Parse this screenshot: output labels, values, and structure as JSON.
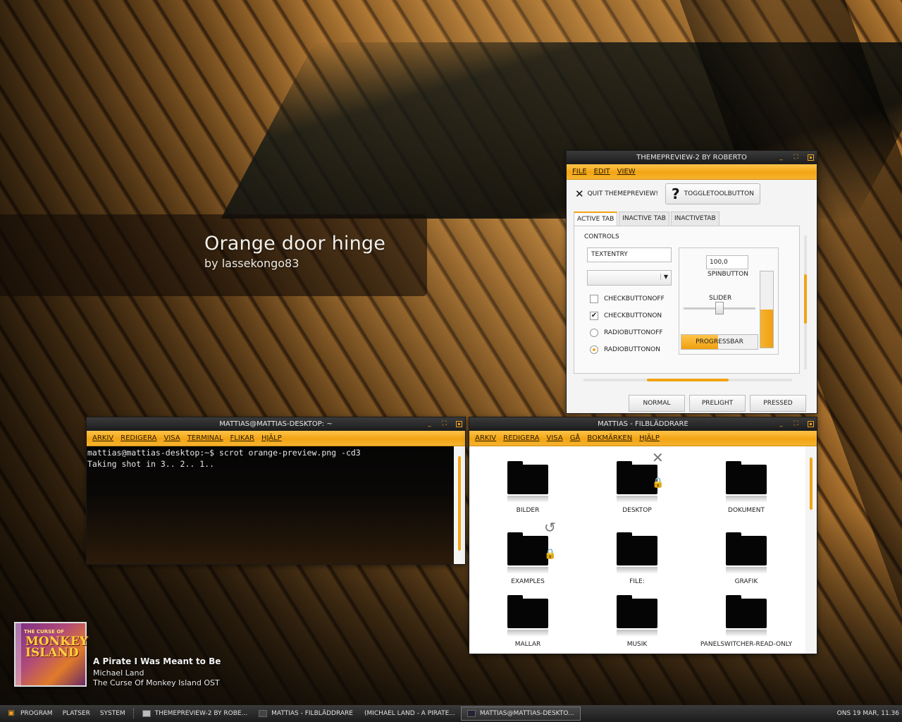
{
  "desktop": {
    "title": "Orange door hinge",
    "subtitle": "by lassekongo83"
  },
  "themepreview": {
    "title": "THEMEPREVIEW-2 BY ROBERTO",
    "menu": [
      "FILE",
      "EDIT",
      "VIEW"
    ],
    "quit_label": "QUIT THEMEPREVIEW!",
    "toggle_label": "TOGGLETOOLBUTTON",
    "tabs": [
      "ACTIVE TAB",
      "INACTIVE TAB",
      "INACTIVETAB"
    ],
    "controls_label": "CONTROLS",
    "textentry": "TEXTENTRY",
    "checkbutton_off": "CHECKBUTTONOFF",
    "checkbutton_on": "CHECKBUTTONON",
    "radiobutton_off": "RADIOBUTTONOFF",
    "radiobutton_on": "RADIOBUTTONON",
    "spin_value": "100,0",
    "spin_label": "SPINBUTTON",
    "slider_label": "SLIDER",
    "slider_value": 0.5,
    "progress_label": "PROGRESSBAR",
    "progress_value": 0.48,
    "vertical_progress_value": 0.5,
    "buttons": [
      "NORMAL",
      "PRELIGHT",
      "PRESSED"
    ]
  },
  "terminal": {
    "title": "MATTIAS@MATTIAS-DESKTOP: ~",
    "menu": [
      "ARKIV",
      "REDIGERA",
      "VISA",
      "TERMINAL",
      "FLIKAR",
      "HJÄLP"
    ],
    "lines": [
      "mattias@mattias-desktop:~$ scrot orange-preview.png -cd3",
      "Taking shot in 3.. 2.. 1.."
    ]
  },
  "filemanager": {
    "title": "MATTIAS - FILBLÄDDRARE",
    "menu": [
      "ARKIV",
      "REDIGERA",
      "VISA",
      "GÅ",
      "BOKMÄRKEN",
      "HJÄLP"
    ],
    "folders": [
      "BILDER",
      "DESKTOP",
      "DOKUMENT",
      "EXAMPLES",
      "FILE:",
      "GRAFIK",
      "MALLAR",
      "MUSIK",
      "PANELSWITCHER-READ-ONLY"
    ]
  },
  "music": {
    "album_art_text_top": "THE CURSE OF",
    "album_art_text_main": "MONKEY ISLAND",
    "song": "A Pirate I Was Meant to Be",
    "artist": "Michael Land",
    "album": "The Curse Of Monkey Island OST"
  },
  "panel": {
    "menus": [
      "PROGRAM",
      "PLATSER",
      "SYSTEM"
    ],
    "tasks": [
      "THEMEPREVIEW-2 BY ROBE...",
      "MATTIAS - FILBLÄDDRARE",
      "(MICHAEL LAND - A PIRATE...",
      "MATTIAS@MATTIAS-DESKTO..."
    ],
    "clock": "ONS 19 MAR, 11.36"
  },
  "colors": {
    "accent": "#f2a414",
    "titlebar": "#1c1c1c"
  }
}
